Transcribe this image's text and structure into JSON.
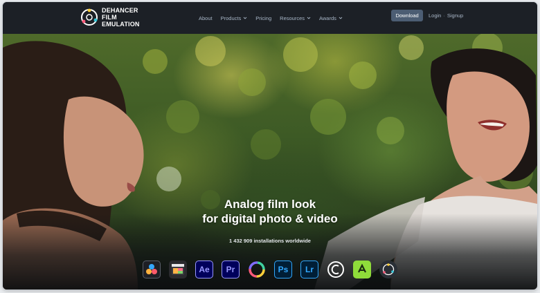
{
  "brand": {
    "line1": "DEHANCER",
    "line2": "FILM",
    "line3": "EMULATION"
  },
  "nav": {
    "items": [
      {
        "label": "About",
        "has_dropdown": false
      },
      {
        "label": "Products",
        "has_dropdown": true
      },
      {
        "label": "Pricing",
        "has_dropdown": false
      },
      {
        "label": "Resources",
        "has_dropdown": true
      },
      {
        "label": "Awards",
        "has_dropdown": true
      }
    ],
    "download_label": "Download",
    "login_label": "Login",
    "separator": "·",
    "signup_label": "Signup"
  },
  "hero": {
    "headline_line1": "Analog film look",
    "headline_line2": "for digital photo & video",
    "installs": "1 432 909 installations worldwide"
  },
  "apps": [
    {
      "name": "davinci-resolve-icon",
      "text": ""
    },
    {
      "name": "final-cut-pro-icon",
      "text": ""
    },
    {
      "name": "after-effects-icon",
      "text": "Ae"
    },
    {
      "name": "premiere-pro-icon",
      "text": "Pr"
    },
    {
      "name": "capture-one-icon",
      "text": ""
    },
    {
      "name": "photoshop-icon",
      "text": "Ps"
    },
    {
      "name": "lightroom-icon",
      "text": "Lr"
    },
    {
      "name": "capture-one-c-icon",
      "text": ""
    },
    {
      "name": "affinity-photo-icon",
      "text": ""
    },
    {
      "name": "dehancer-app-icon",
      "text": ""
    }
  ],
  "colors": {
    "header_bg": "#1c2026",
    "nav_text": "#a9b7c8",
    "download_bg": "#4c5d73",
    "adobe_video_bg": "#00005b",
    "adobe_video_fg": "#9999ff",
    "adobe_photo_bg": "#001e36",
    "adobe_photo_fg": "#31a8ff"
  }
}
